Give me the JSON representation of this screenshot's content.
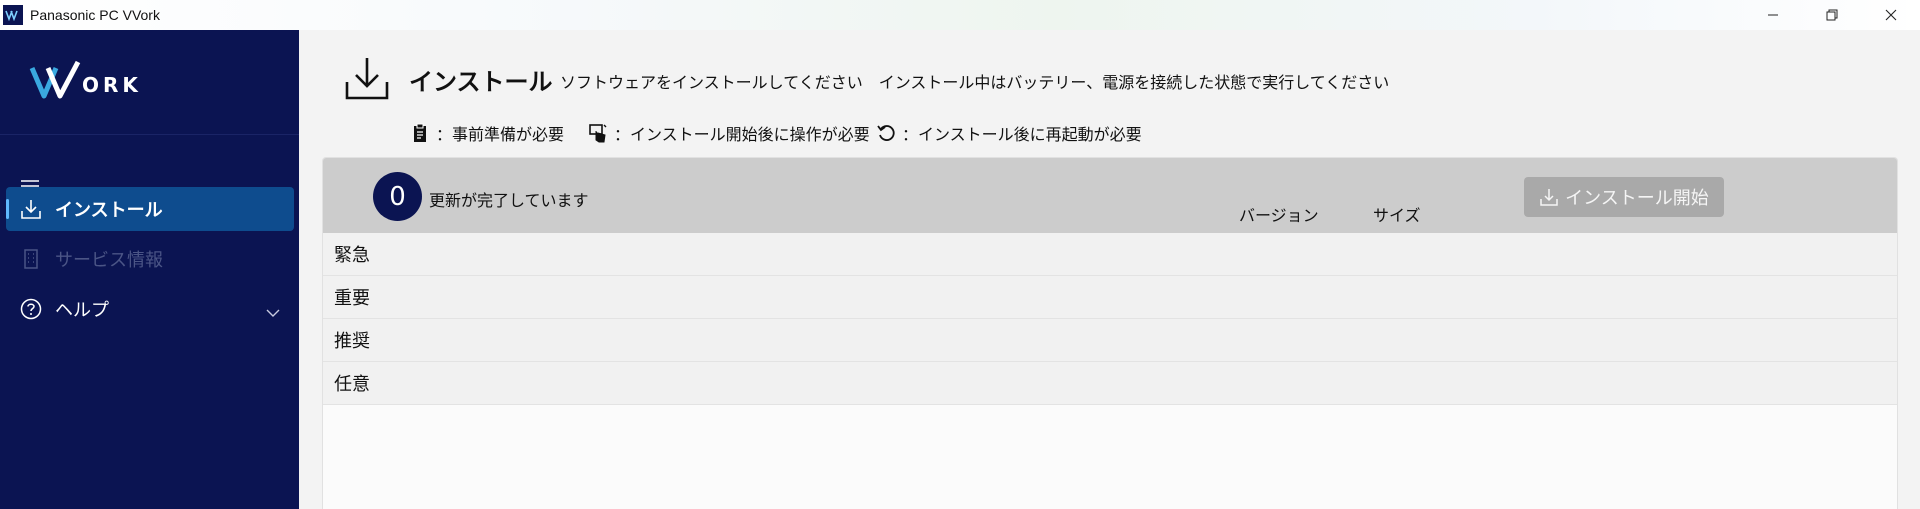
{
  "window": {
    "title": "Panasonic PC VVork",
    "controls": [
      "minimize-icon",
      "restore-icon",
      "close-icon"
    ]
  },
  "sidebar": {
    "logo_text": "VVORK",
    "menu_icon": "hamburger-icon",
    "items": [
      {
        "label": "インストール",
        "icon": "download-icon",
        "active": true,
        "enabled": true
      },
      {
        "label": "サービス情報",
        "icon": "building-icon",
        "active": false,
        "enabled": false
      },
      {
        "label": "ヘルプ",
        "icon": "help-circle-icon",
        "active": false,
        "enabled": true,
        "expandable": true
      }
    ]
  },
  "header": {
    "title": "インストール",
    "description": "ソフトウェアをインストールしてください　インストール中はバッテリー、電源を接続した状態で実行してください",
    "legend": [
      {
        "icon": "clipboard-icon",
        "text": "：事前準備が必要"
      },
      {
        "icon": "touch-hand-icon",
        "text": "：インストール開始後に操作が必要"
      },
      {
        "icon": "restart-icon",
        "text": "：インストール後に再起動が必要"
      }
    ]
  },
  "updates": {
    "count": "0",
    "status": "更新が完了しています",
    "columns": {
      "version": "バージョン",
      "size": "サイズ"
    },
    "install_button": "インストール開始",
    "install_button_enabled": false,
    "categories": [
      "緊急",
      "重要",
      "推奨",
      "任意"
    ]
  },
  "colors": {
    "sidebar_bg": "#0b1452",
    "active_item": "#0e4c8e",
    "accent": "#5fb8ff",
    "badge_bg": "#0b1452",
    "disabled_button": "#a9a9a9"
  }
}
